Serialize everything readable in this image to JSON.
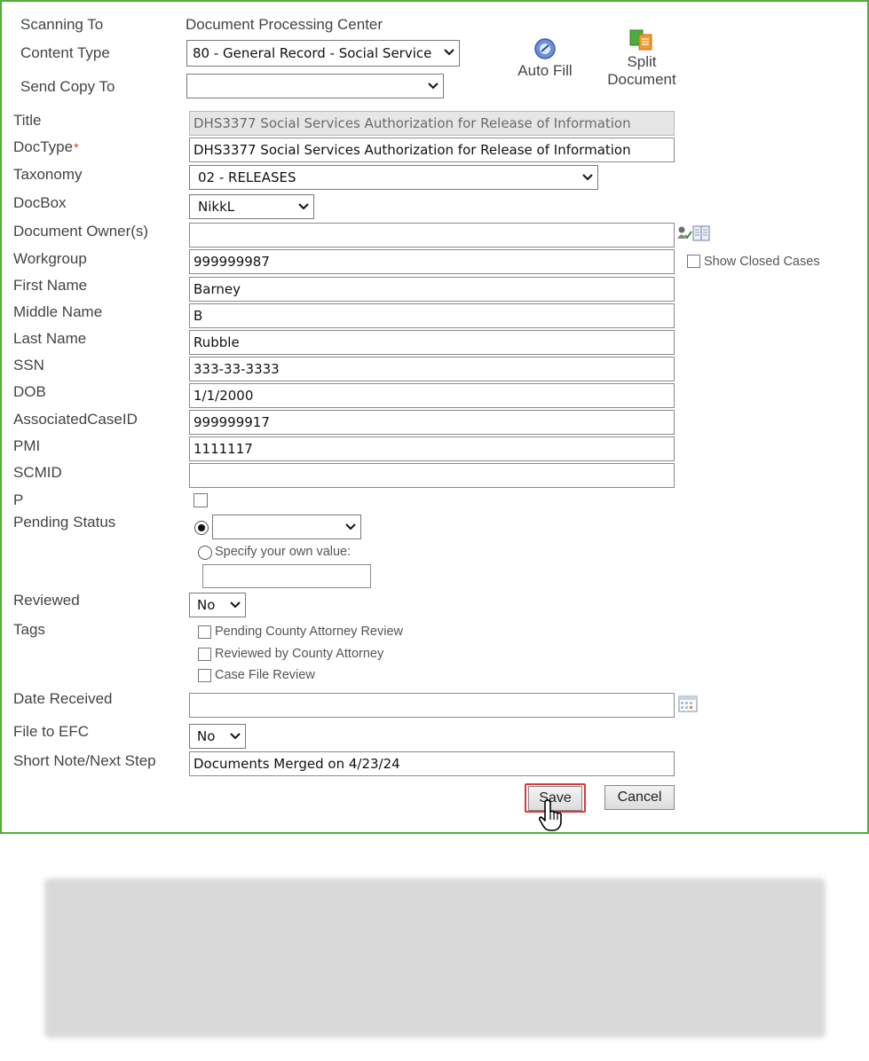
{
  "header": {
    "scanning_to_label": "Scanning To",
    "scanning_to_value": "Document Processing Center",
    "content_type_label": "Content Type",
    "content_type_value": "80 - General Record - Social Service",
    "send_copy_label": "Send Copy To",
    "send_copy_value": ""
  },
  "tools": {
    "auto_fill_label": "Auto Fill",
    "split_document_label_1": "Split",
    "split_document_label_2": "Document"
  },
  "fields": {
    "title_label": "Title",
    "title_value": "DHS3377 Social Services Authorization for Release of Information",
    "doctype_label": "DocType",
    "doctype_required": "*",
    "doctype_value": "DHS3377 Social Services Authorization for Release of Information",
    "taxonomy_label": "Taxonomy",
    "taxonomy_value": "02 - RELEASES",
    "docbox_label": "DocBox",
    "docbox_value": "NikkL",
    "owner_label": "Document Owner(s)",
    "owner_value": "",
    "workgroup_label": "Workgroup",
    "workgroup_value": "999999987",
    "show_closed_label": "Show Closed Cases",
    "first_name_label": "First Name",
    "first_name_value": "Barney",
    "middle_name_label": "Middle Name",
    "middle_name_value": "B",
    "last_name_label": "Last Name",
    "last_name_value": "Rubble",
    "ssn_label": "SSN",
    "ssn_value": "333-33-3333",
    "dob_label": "DOB",
    "dob_value": "1/1/2000",
    "case_id_label": "AssociatedCaseID",
    "case_id_value": "999999917",
    "pmi_label": "PMI",
    "pmi_value": "1111117",
    "scmid_label": "SCMID",
    "scmid_value": "",
    "p_label": "P",
    "pending_status_label": "Pending Status",
    "pending_status_value": "",
    "specify_own_label": "Specify your own value:",
    "specify_own_value": "",
    "reviewed_label": "Reviewed",
    "reviewed_value": "No",
    "tags_label": "Tags",
    "tags": [
      "Pending County Attorney Review",
      "Reviewed by County Attorney",
      "Case File Review"
    ],
    "date_received_label": "Date Received",
    "date_received_value": "",
    "file_to_efc_label": "File to EFC",
    "file_to_efc_value": "No",
    "short_note_label": "Short Note/Next Step",
    "short_note_value": "Documents Merged on 4/23/24"
  },
  "actions": {
    "save_label": "Save",
    "cancel_label": "Cancel"
  },
  "colors": {
    "frame_border": "#4fae3a",
    "required_mark": "#e0301e",
    "save_highlight": "#d9383a"
  }
}
